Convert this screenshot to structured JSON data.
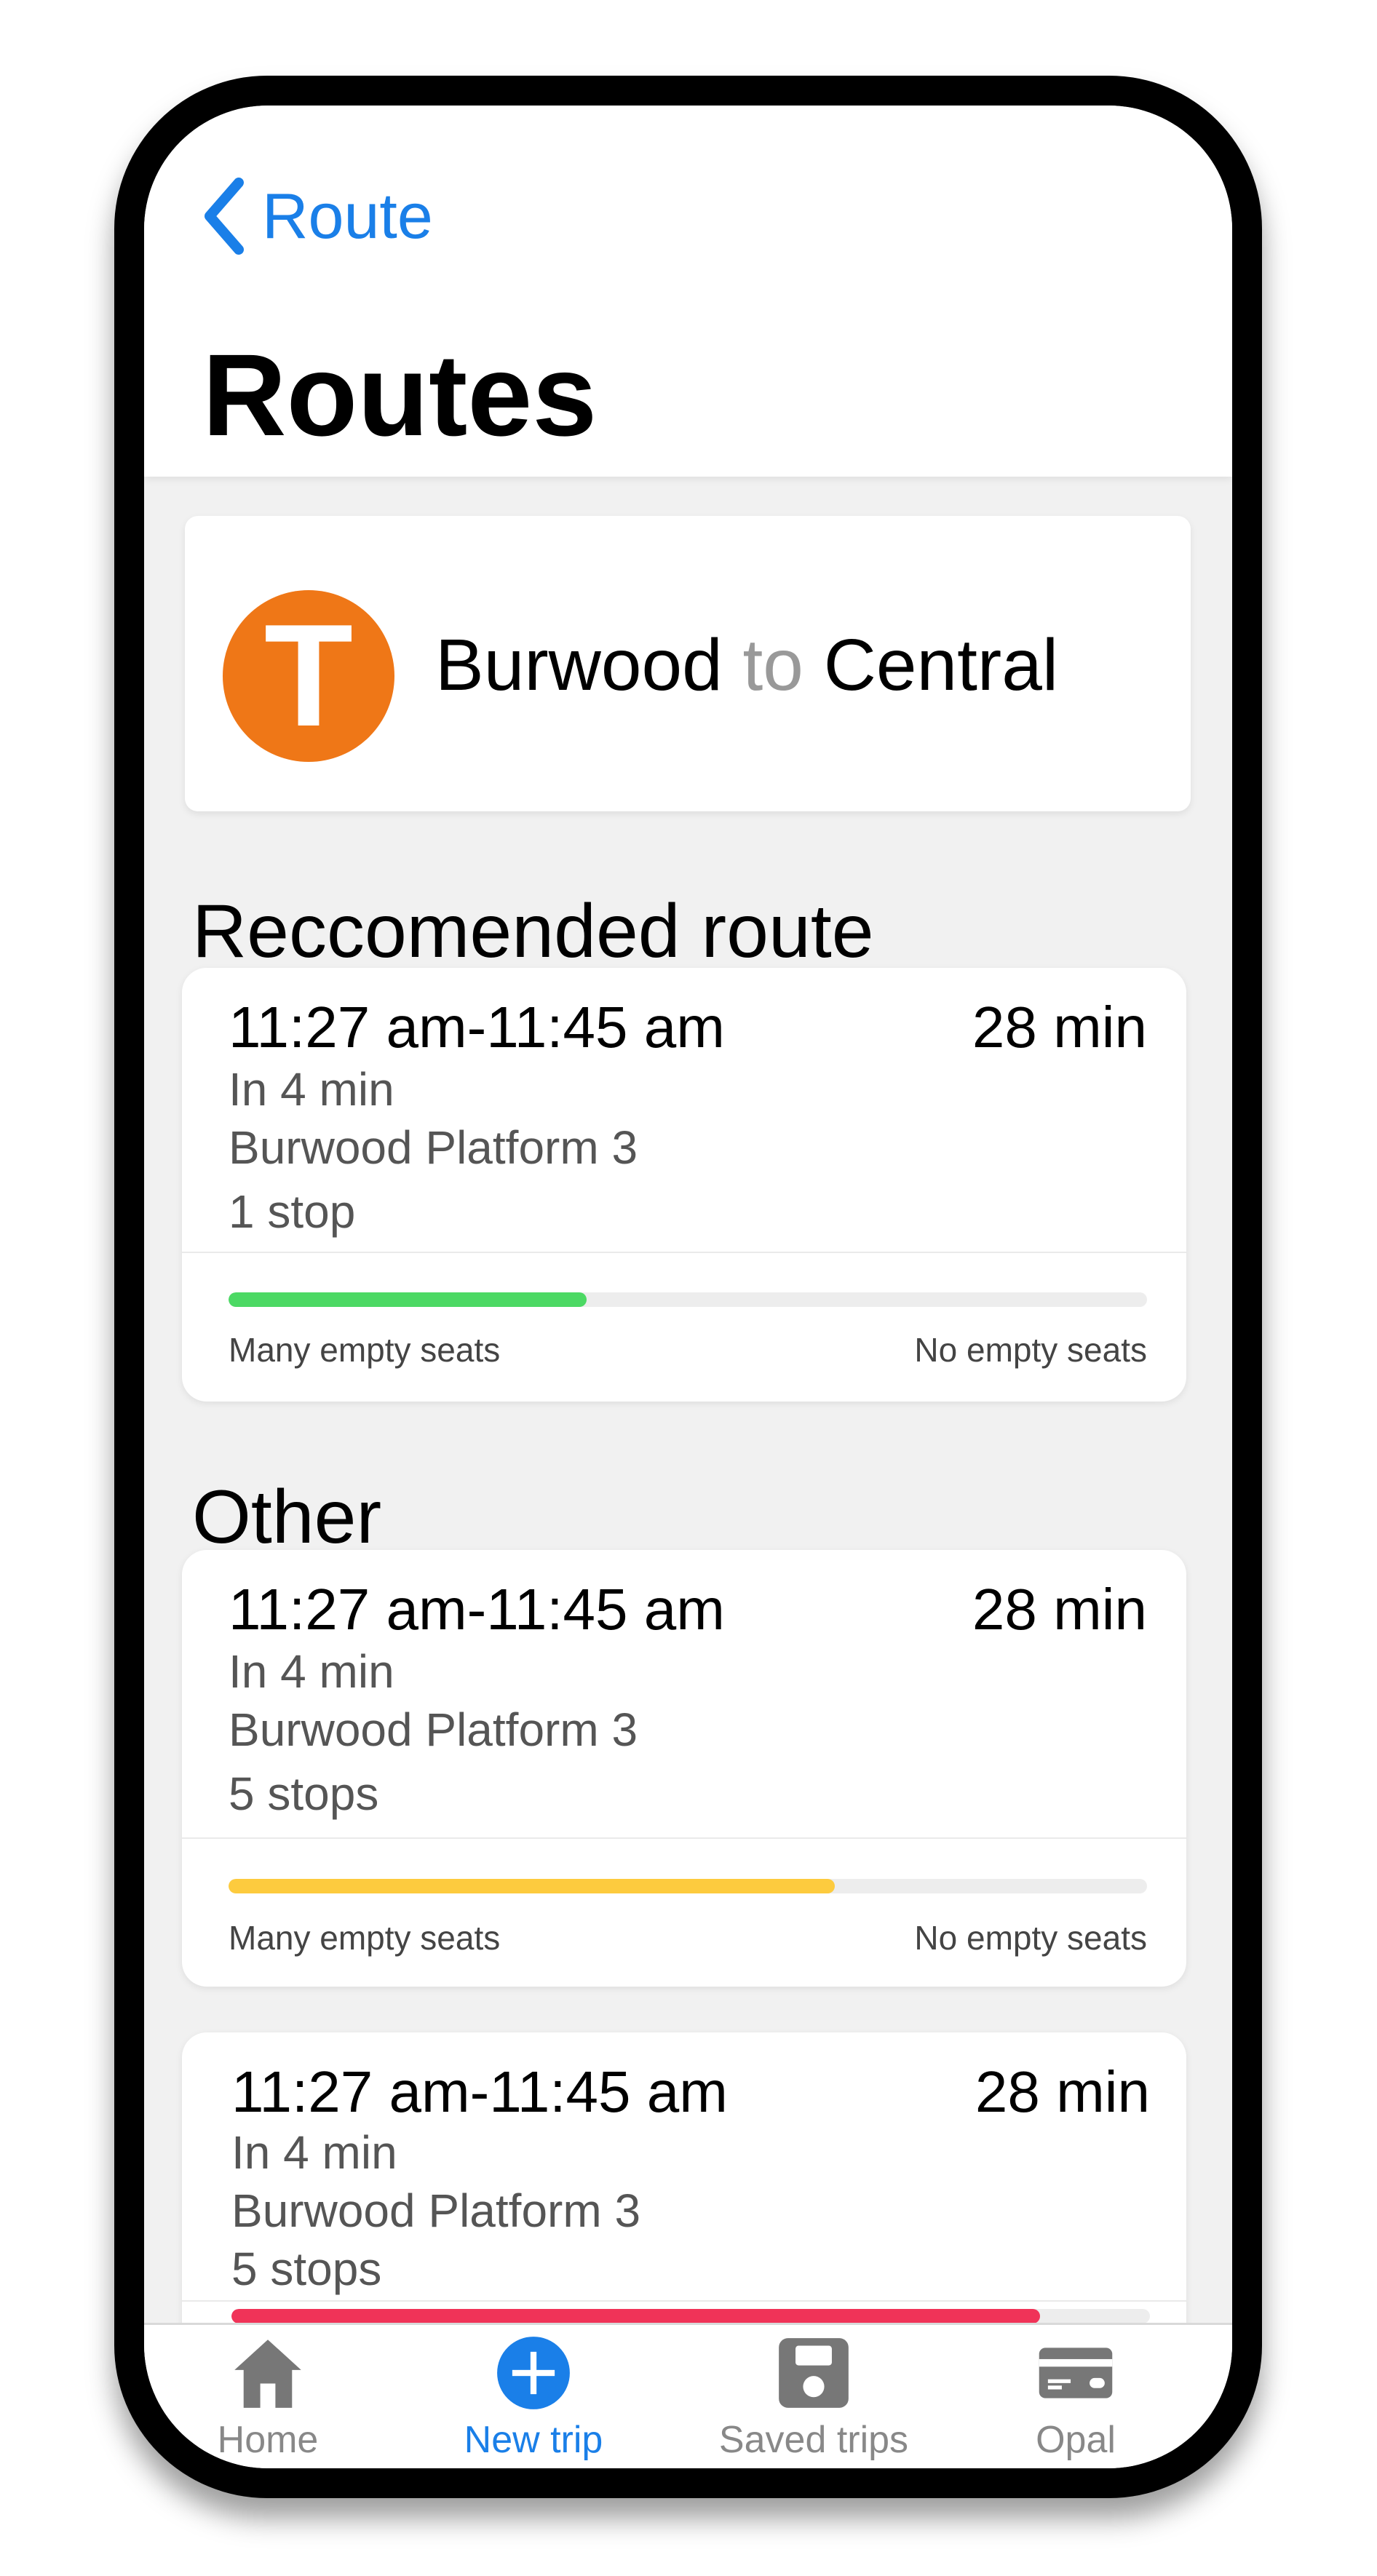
{
  "nav": {
    "back_label": "Route",
    "title": "Routes"
  },
  "trip": {
    "logo_letter": "T",
    "origin": "Burwood",
    "connector": "to",
    "destination": "Central"
  },
  "sections": {
    "recommended": "Reccomended route",
    "other": "Other"
  },
  "routes": [
    {
      "time": "11:27 am-11:45 am",
      "duration": "28 min",
      "departs": "In 4 min",
      "platform": "Burwood Platform 3",
      "stops": "1 stop",
      "occupancy": 0.39,
      "bar_color": "#4cd964",
      "label_low": "Many empty seats",
      "label_high": "No empty seats"
    },
    {
      "time": "11:27 am-11:45 am",
      "duration": "28 min",
      "departs": "In 4 min",
      "platform": "Burwood Platform 3",
      "stops": "5 stops",
      "occupancy": 0.66,
      "bar_color": "#fdcb3e",
      "label_low": "Many empty seats",
      "label_high": "No empty seats"
    },
    {
      "time": "11:27 am-11:45 am",
      "duration": "28 min",
      "departs": "In 4 min",
      "platform": "Burwood Platform 3",
      "stops": "5 stops",
      "occupancy": 0.88,
      "bar_color": "#f03358"
    }
  ],
  "tabs": [
    {
      "label": "Home",
      "icon": "home-icon",
      "active": false
    },
    {
      "label": "New trip",
      "icon": "plus-circle-icon",
      "active": true
    },
    {
      "label": "Saved trips",
      "icon": "save-icon",
      "active": false
    },
    {
      "label": "Opal",
      "icon": "card-icon",
      "active": false
    }
  ],
  "colors": {
    "accent": "#1a7fe8",
    "train_orange": "#ef7717",
    "inactive": "#888888"
  }
}
